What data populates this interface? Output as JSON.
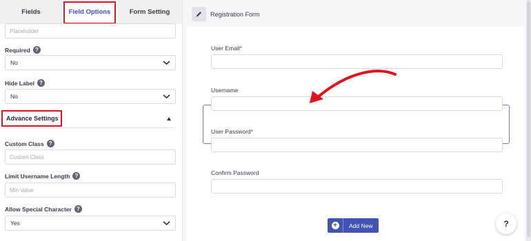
{
  "tabs": {
    "fields": "Fields",
    "field_options": "Field Options",
    "form_setting": "Form Setting"
  },
  "left": {
    "placeholder_input": {
      "placeholder": "Placeholder"
    },
    "required": {
      "label": "Required",
      "value": "No"
    },
    "hide_label": {
      "label": "Hide Label",
      "value": "No"
    },
    "advance_settings": {
      "title": "Advance Settings"
    },
    "custom_class": {
      "label": "Custom Class",
      "placeholder": "Custom Class"
    },
    "limit_username_length": {
      "label": "Limit Username Length",
      "placeholder": "Min Value"
    },
    "allow_special_character": {
      "label": "Allow Special Character",
      "value": "Yes"
    }
  },
  "right": {
    "form_title": "Registration Form",
    "fields": [
      {
        "label": "User Email",
        "required": "*"
      },
      {
        "label": "Username",
        "required": ""
      },
      {
        "label": "User Password",
        "required": "*"
      },
      {
        "label": "Confirm Password",
        "required": ""
      }
    ],
    "add_new": "Add New",
    "help": "?"
  },
  "colors": {
    "accent": "#3a4ed5",
    "button": "#4353b3",
    "highlight": "#e0141e",
    "required": "#d11a2a"
  },
  "icons": [
    "pencil-icon",
    "question-icon",
    "chevron-down-icon",
    "caret-up-icon",
    "plus-circle-icon",
    "curved-arrow-annotation"
  ]
}
